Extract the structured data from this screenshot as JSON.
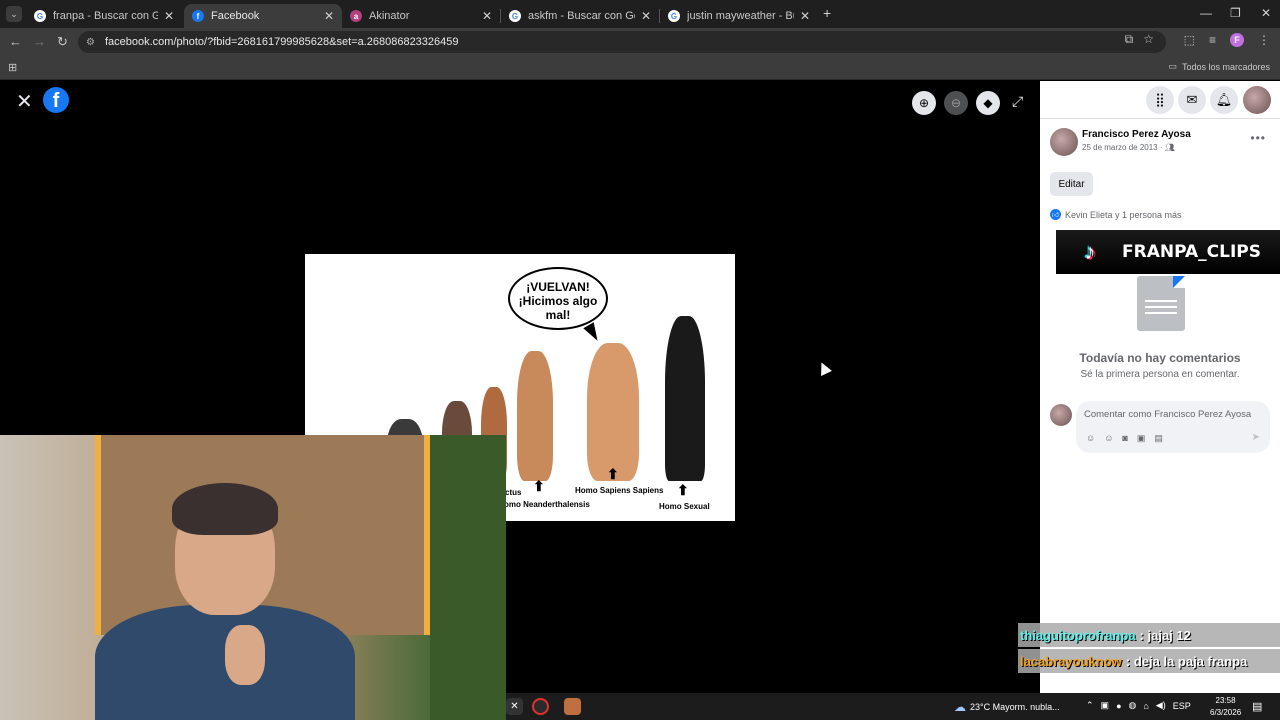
{
  "browser": {
    "tabs": [
      {
        "title": "franpa - Buscar con Google",
        "favicon": "google-icon"
      },
      {
        "title": "Facebook",
        "favicon": "facebook-icon",
        "active": true
      },
      {
        "title": "Akinator",
        "favicon": "akinator-icon"
      },
      {
        "title": "askfm - Buscar con Google",
        "favicon": "google-icon"
      },
      {
        "title": "justin mayweather - Buscar con",
        "favicon": "google-icon"
      }
    ],
    "url": "facebook.com/photo/?fbid=268161799985628&set=a.268086823326459",
    "profile_initial": "F",
    "bookmarks_label": "Todos los marcadores"
  },
  "viewer": {
    "meme": {
      "bubble_lines": [
        "¡VUELVAN!",
        "¡Hicimos algo",
        "mal!"
      ],
      "captions": {
        "erectus": "ctus",
        "neanderthal": "omo Neanderthalensis",
        "sapiens": "Homo Sapiens Sapiens",
        "sexual": "Homo Sexual"
      }
    }
  },
  "sidebar": {
    "author": "Francisco Perez Ayosa",
    "date": "25 de marzo de 2013 ·",
    "edit_label": "Editar",
    "likes_text": "Kevin Elieta y 1 persona más",
    "no_comments": "Todavía no hay comentarios",
    "be_first": "Sé la primera persona en comentar.",
    "comment_placeholder": "Comentar como Francisco Perez Ayosa"
  },
  "overlay": {
    "banner_text": "FRANPA_CLIPS",
    "chat": [
      {
        "user": "thiaguitoprofranpa",
        "message": ": jajaj 12"
      },
      {
        "user": "lacabrayouknow",
        "message": ": deja la paja franpa"
      }
    ]
  },
  "taskbar": {
    "weather": "23°C  Mayorm. nubla...",
    "lang": "ESP",
    "time": "23:58",
    "date": "6/3/2026"
  }
}
